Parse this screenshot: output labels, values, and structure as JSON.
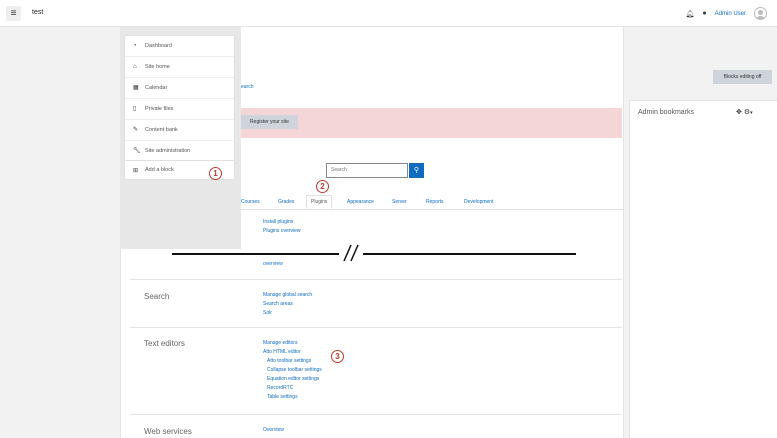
{
  "header": {
    "site_name": "test",
    "user_name": "Admin User"
  },
  "drawer": {
    "items": [
      {
        "icon": "dashboard-icon",
        "label": "Dashboard"
      },
      {
        "icon": "home-icon",
        "label": "Site home"
      },
      {
        "icon": "calendar-icon",
        "label": "Calendar"
      },
      {
        "icon": "file-icon",
        "label": "Private files"
      },
      {
        "icon": "pencil-icon",
        "label": "Content bank"
      },
      {
        "icon": "wrench-icon",
        "label": "Site administration"
      }
    ],
    "add_block": "Add a block"
  },
  "main": {
    "breadcrumb_tail": "earch",
    "blocks_editing_button": "Blocks editing off",
    "register_button": "Register your site",
    "search_placeholder": "Search",
    "tabs": [
      "Courses",
      "Grades",
      "Plugins",
      "Appearance",
      "Server",
      "Reports",
      "Development"
    ],
    "active_tab": "Plugins",
    "plugins_links": [
      "Install plugins",
      "Plugins overview"
    ],
    "cut_link": "overview",
    "search_section": {
      "title": "Search",
      "links": [
        "Manage global search",
        "Search areas",
        "Solr"
      ]
    },
    "text_editors_section": {
      "title": "Text editors",
      "links": [
        "Manage editors",
        "Atto HTML editor"
      ],
      "sub_links": [
        "Atto toolbar settings",
        "Collapse toolbar settings",
        "Equation editor settings",
        "RecordRTC",
        "Table settings"
      ]
    },
    "web_services_section": {
      "title": "Web services",
      "links": [
        "Overview"
      ]
    }
  },
  "right_panel": {
    "title": "Admin bookmarks"
  },
  "annotations": [
    "1",
    "2",
    "3"
  ],
  "colors": {
    "link": "#0f6cbf",
    "alert_bg": "#f5d6d6",
    "annotation": "#c0392b",
    "drawer_bg": "#e7e7e7"
  }
}
